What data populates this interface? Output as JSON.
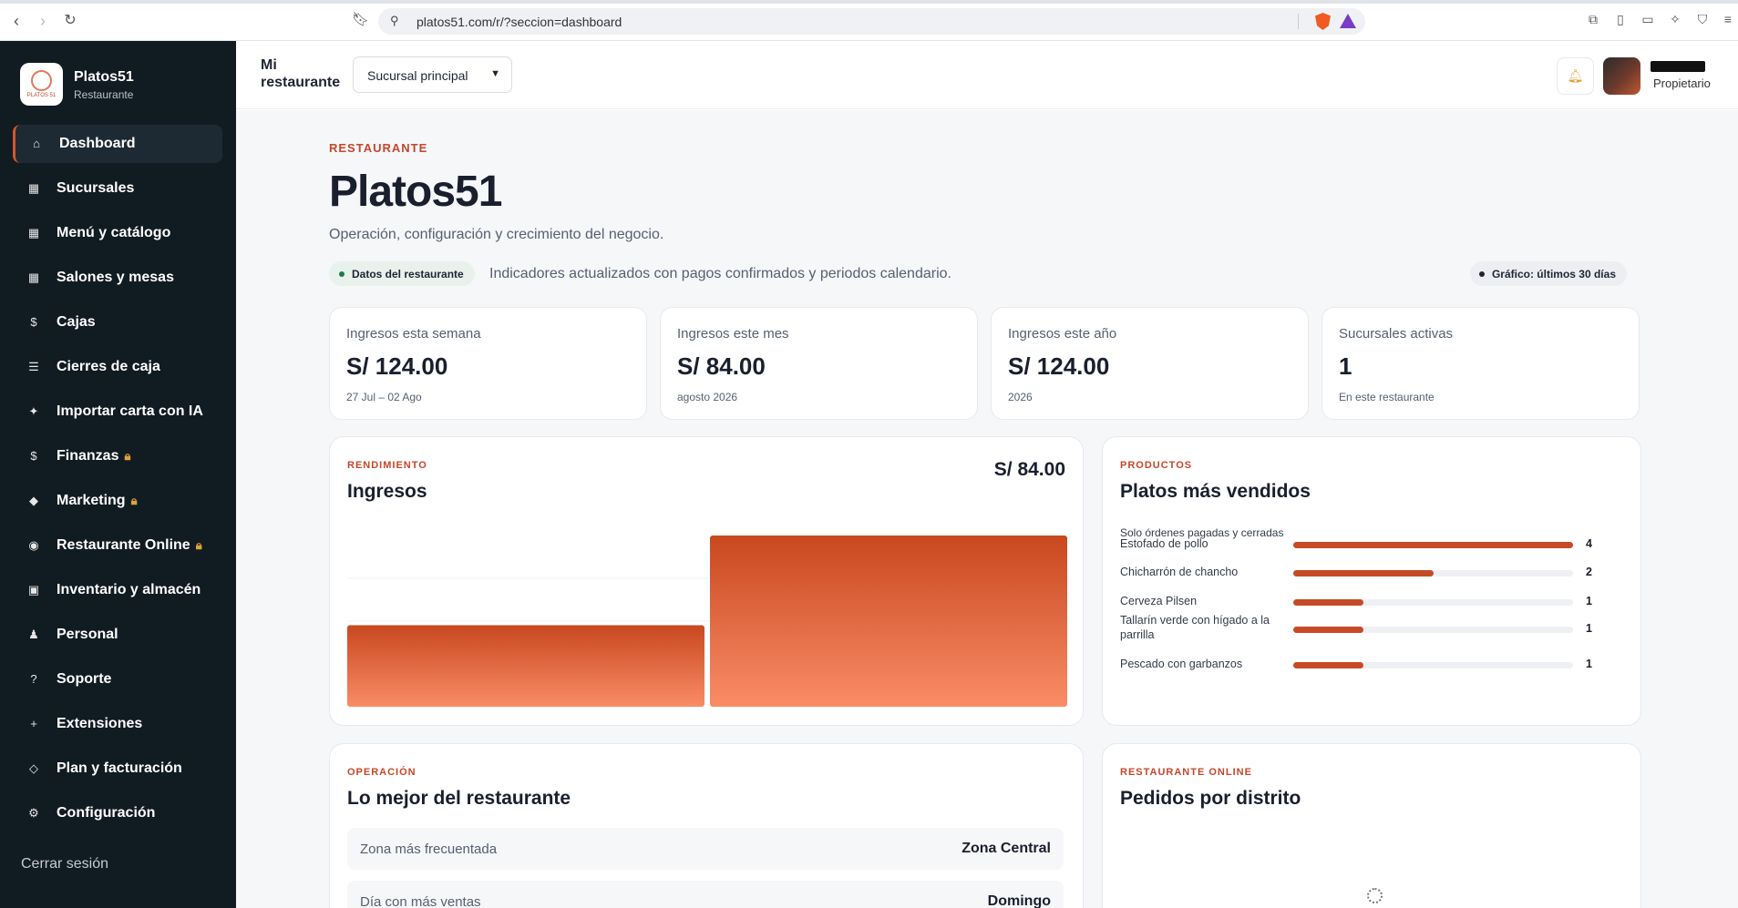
{
  "browser": {
    "url": "platos51.com/r/?seccion=dashboard"
  },
  "brand": {
    "name": "Platos51",
    "subtitle": "Restaurante",
    "logo_text": "PLATOS 51"
  },
  "sidebar": {
    "items": [
      {
        "icon": "⌂",
        "label": "Dashboard",
        "locked": false,
        "active": true
      },
      {
        "icon": "▦",
        "label": "Sucursales",
        "locked": false
      },
      {
        "icon": "▦",
        "label": "Menú y catálogo",
        "locked": false
      },
      {
        "icon": "▦",
        "label": "Salones y mesas",
        "locked": false
      },
      {
        "icon": "$",
        "label": "Cajas",
        "locked": false
      },
      {
        "icon": "☰",
        "label": "Cierres de caja",
        "locked": false
      },
      {
        "icon": "✦",
        "label": "Importar carta con IA",
        "locked": false
      },
      {
        "icon": "$",
        "label": "Finanzas",
        "locked": true
      },
      {
        "icon": "◆",
        "label": "Marketing",
        "locked": true
      },
      {
        "icon": "◉",
        "label": "Restaurante Online",
        "locked": true
      },
      {
        "icon": "▣",
        "label": "Inventario y almacén",
        "locked": false
      },
      {
        "icon": "♟",
        "label": "Personal",
        "locked": false
      },
      {
        "icon": "?",
        "label": "Soporte",
        "locked": false
      },
      {
        "icon": "+",
        "label": "Extensiones",
        "locked": false
      },
      {
        "icon": "◇",
        "label": "Plan y facturación",
        "locked": false
      },
      {
        "icon": "⚙",
        "label": "Configuración",
        "locked": false
      }
    ],
    "logout_label": "Cerrar sesión"
  },
  "header": {
    "restaurant_label": "Mi restaurante",
    "branch_selected": "Sucursal principal",
    "user_role": "Propietario"
  },
  "page": {
    "eyebrow": "RESTAURANTE",
    "title": "Platos51",
    "subtitle": "Operación, configuración y crecimiento del negocio.",
    "data_chip": "Datos del restaurante",
    "info_line": "Indicadores actualizados con pagos confirmados y periodos calendario.",
    "range_chip": "Gráfico: últimos 30 días"
  },
  "kpis": [
    {
      "label": "Ingresos esta semana",
      "value": "S/ 124.00",
      "note": "27 Jul – 02 Ago"
    },
    {
      "label": "Ingresos este mes",
      "value": "S/ 84.00",
      "note": "agosto 2026"
    },
    {
      "label": "Ingresos este año",
      "value": "S/ 124.00",
      "note": "2026"
    },
    {
      "label": "Sucursales activas",
      "value": "1",
      "note": "En este restaurante"
    }
  ],
  "revenue": {
    "eyebrow": "RENDIMIENTO",
    "title": "Ingresos",
    "total": "S/ 84.00"
  },
  "chart_data": {
    "type": "bar",
    "categories": [
      "",
      ""
    ],
    "values": [
      40,
      84
    ],
    "ylim": [
      0,
      84
    ],
    "grid": true,
    "bar_gradient": [
      "#c8481f",
      "#f98c66"
    ]
  },
  "products": {
    "eyebrow": "PRODUCTOS",
    "title": "Platos más vendidos",
    "note": "Solo órdenes pagadas y cerradas",
    "max": 4,
    "items": [
      {
        "name": "Estofado de pollo",
        "count": 4
      },
      {
        "name": "Chicharrón de chancho",
        "count": 2
      },
      {
        "name": "Cerveza Pilsen",
        "count": 1
      },
      {
        "name": "Tallarín verde con hígado a la parrilla",
        "count": 1
      },
      {
        "name": "Pescado con garbanzos",
        "count": 1
      }
    ]
  },
  "operation": {
    "eyebrow": "OPERACIÓN",
    "title": "Lo mejor del restaurante",
    "rows": [
      {
        "label": "Zona más frecuentada",
        "value": "Zona Central"
      },
      {
        "label": "Día con más ventas",
        "value": "Domingo"
      }
    ]
  },
  "online": {
    "eyebrow": "RESTAURANTE ONLINE",
    "title": "Pedidos por distrito"
  },
  "colors": {
    "accent": "#c4472a",
    "sidebar_bg": "#111b22",
    "bar_fill": "#c74a27"
  }
}
